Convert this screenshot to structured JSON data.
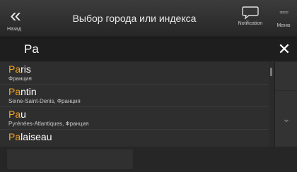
{
  "header": {
    "back_label": "Назад",
    "title": "Выбор города или индекса",
    "notification_label": "Notification",
    "menu_label": "Меню"
  },
  "search": {
    "value": "Pa"
  },
  "results": [
    {
      "prefix": "Pa",
      "rest": "ris",
      "subtitle": "Франция"
    },
    {
      "prefix": "Pa",
      "rest": "ntin",
      "subtitle": "Seine-Saint-Denis, Франция"
    },
    {
      "prefix": "Pa",
      "rest": "u",
      "subtitle": "Pyrénées-Atlantiques, Франция"
    },
    {
      "prefix": "Pa",
      "rest": "laiseau",
      "subtitle": ""
    }
  ],
  "icons": {
    "back": "double-chevron-left-icon",
    "notification": "speech-bubble-icon",
    "menu": "grid-dots-icon",
    "close": "close-icon",
    "scroll_down": "chevron-down-icon"
  },
  "colors": {
    "highlight": "#f5a623",
    "text": "#ffffff",
    "background": "#2b2b2b"
  }
}
